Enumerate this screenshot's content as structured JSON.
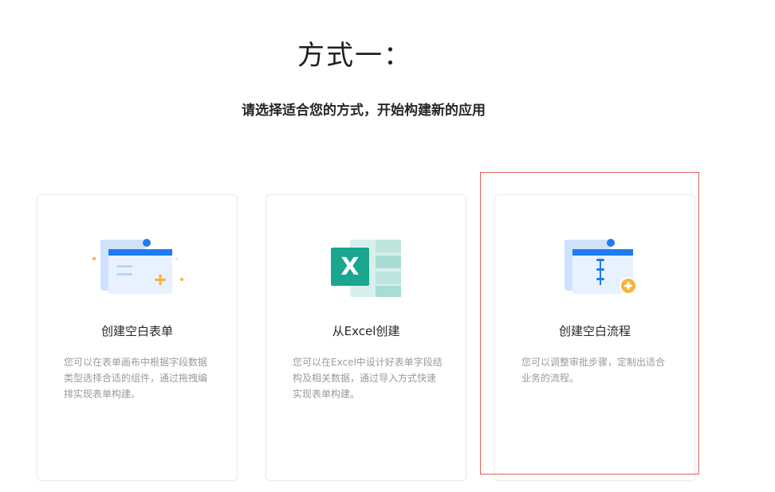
{
  "header": {
    "title": "方式一：",
    "subtitle": "请选择适合您的方式，开始构建新的应用"
  },
  "cards": [
    {
      "title": "创建空白表单",
      "description": "您可以在表单画布中根据字段数据类型选择合适的组件，通过拖拽编排实现表单构建。",
      "icon": "blank-form-icon"
    },
    {
      "title": "从Excel创建",
      "description": "您可以在Excel中设计好表单字段结构及相关数据，通过导入方式快速实现表单构建。",
      "icon": "excel-icon"
    },
    {
      "title": "创建空白流程",
      "description": "您可以调整审批步骤，定制出适合业务的流程。",
      "icon": "blank-process-icon"
    }
  ],
  "colors": {
    "accent_blue": "#1e7bf0",
    "excel_green": "#1aa68f",
    "plus_orange": "#fbb13c",
    "highlight_red": "#e0605a"
  }
}
